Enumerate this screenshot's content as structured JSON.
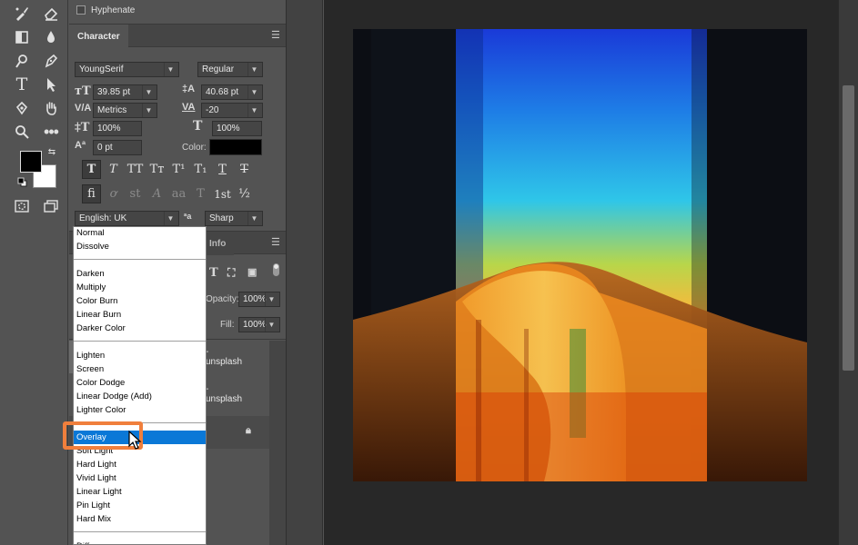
{
  "hyphenate_label": "Hyphenate",
  "character": {
    "tab_label": "Character",
    "font_family": "YoungSerif",
    "font_style": "Regular",
    "font_size": "39.85 pt",
    "leading": "40.68 pt",
    "kerning": "Metrics",
    "tracking": "-20",
    "vertical_scale": "100%",
    "horizontal_scale": "100%",
    "baseline_shift": "0 pt",
    "color_label": "Color:",
    "color_value": "#000000",
    "language": "English: UK",
    "antialias_icon_text": "aa",
    "antialias": "Sharp",
    "fraction_glyph": "½",
    "ordinal_glyph": "1st"
  },
  "layers": {
    "info_tab": "Info",
    "opacity_label": "Opacity:",
    "opacity_value": "100%",
    "fill_label": "Fill:",
    "fill_value": "100%",
    "layer1_name": "-unsplash",
    "layer2_name": "-unsplash"
  },
  "blend_modes": {
    "groups": [
      [
        "Normal",
        "Dissolve"
      ],
      [
        "Darken",
        "Multiply",
        "Color Burn",
        "Linear Burn",
        "Darker Color"
      ],
      [
        "Lighten",
        "Screen",
        "Color Dodge",
        "Linear Dodge (Add)",
        "Lighter Color"
      ],
      [
        "Overlay",
        "Soft Light",
        "Hard Light",
        "Vivid Light",
        "Linear Light",
        "Pin Light",
        "Hard Mix"
      ],
      [
        "Difference"
      ]
    ],
    "selected": "Overlay"
  },
  "colors": {
    "highlight": "#f07f3c",
    "selection": "#0a78d7",
    "foreground": "#000000",
    "background": "#ffffff"
  },
  "icons": [
    "brush-icon",
    "eraser-icon",
    "rectangle-icon",
    "drop-icon",
    "dodge-icon",
    "pen-icon",
    "type-icon",
    "path-select-icon",
    "transform-icon",
    "hand-icon",
    "zoom-icon",
    "more-icon",
    "swap-icon",
    "default-colors-icon",
    "quick-mask-icon",
    "screen-mode-icon",
    "panel-menu-icon",
    "lock-icon"
  ]
}
